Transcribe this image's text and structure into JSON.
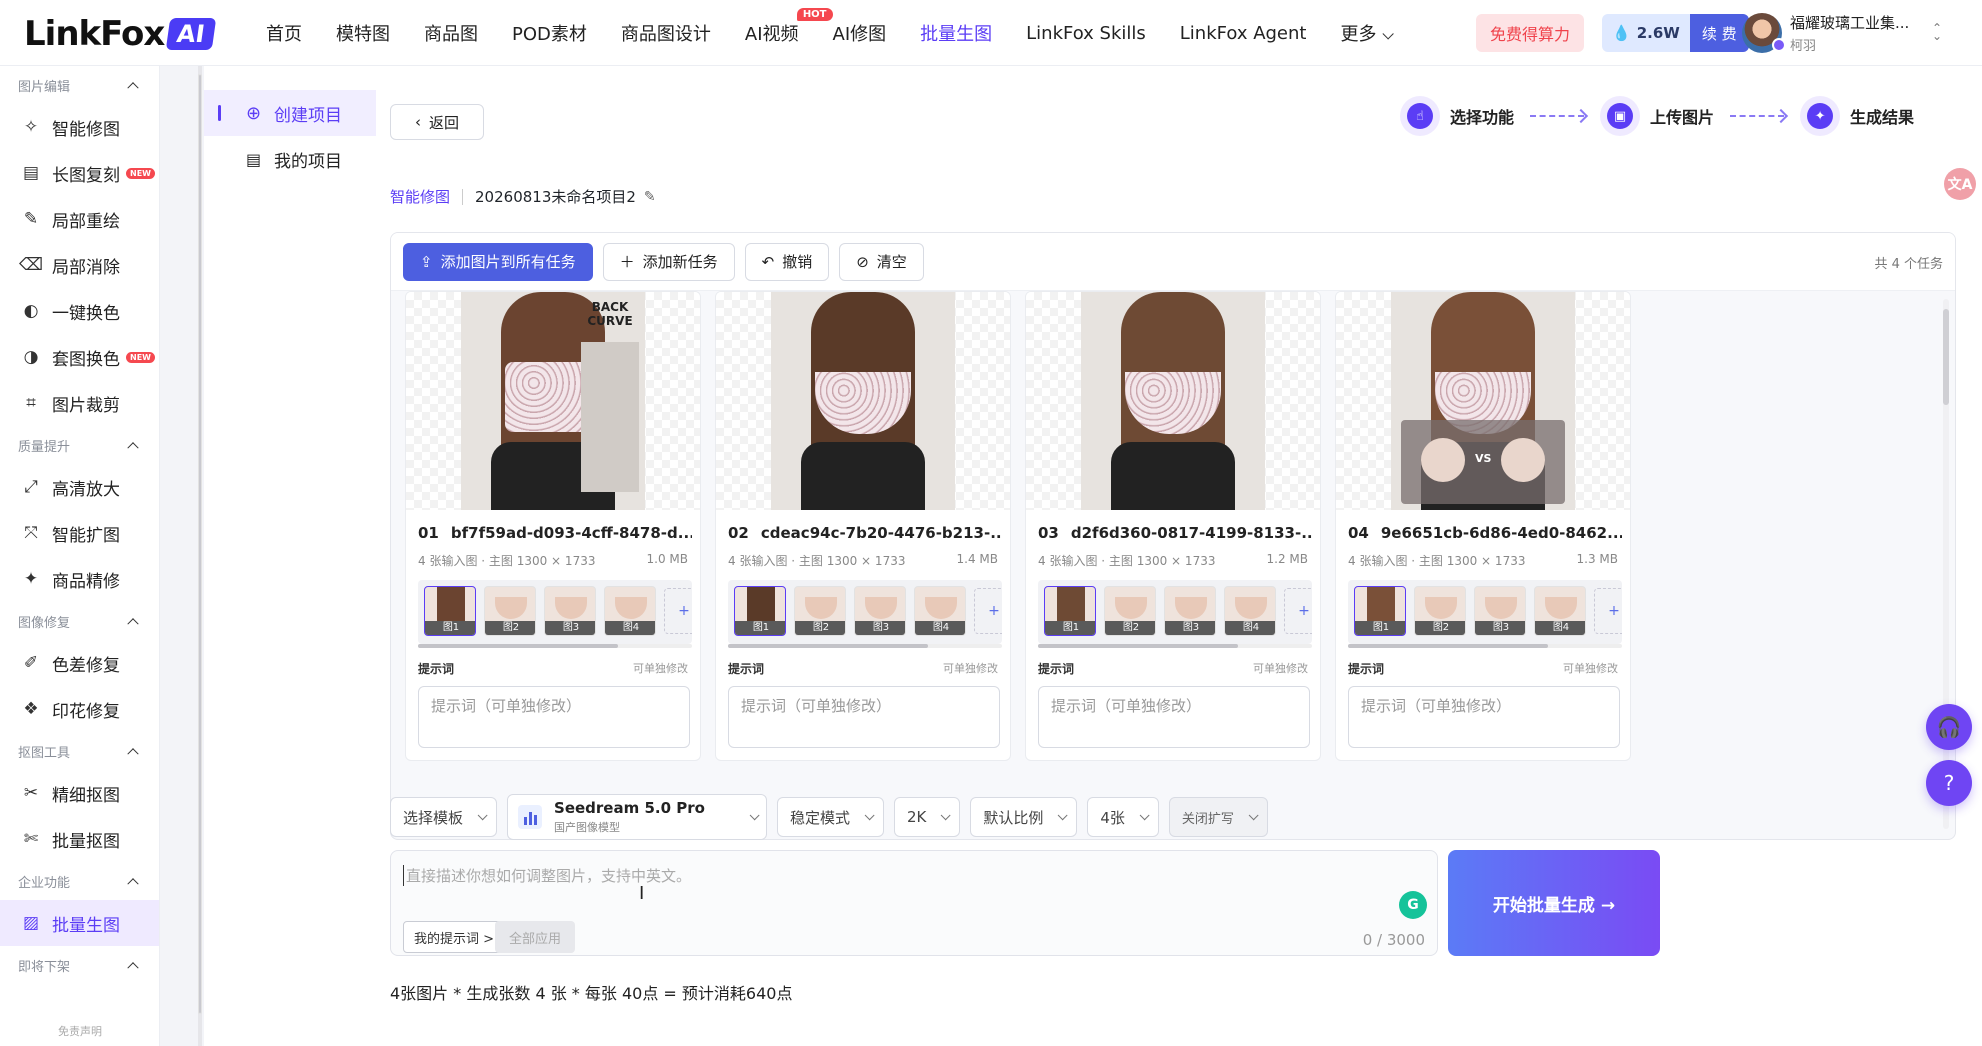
{
  "brand": {
    "name": "LinkFox",
    "badge": "AI"
  },
  "nav": [
    {
      "label": "首页"
    },
    {
      "label": "模特图"
    },
    {
      "label": "商品图"
    },
    {
      "label": "POD素材"
    },
    {
      "label": "商品图设计"
    },
    {
      "label": "AI视频",
      "badge": "HOT"
    },
    {
      "label": "AI修图"
    },
    {
      "label": "批量生图",
      "active": true
    },
    {
      "label": "LinkFox Skills"
    },
    {
      "label": "LinkFox Agent"
    },
    {
      "label": "更多"
    }
  ],
  "header": {
    "free_label": "免费得算力",
    "credits": "2.6W",
    "renew_label": "续 费",
    "user_name": "福耀玻璃工业集...",
    "user_sub": "柯羽"
  },
  "sidebar": {
    "sections": [
      {
        "title": "图片编辑",
        "items": [
          {
            "label": "智能修图",
            "icon": "wand-icon"
          },
          {
            "label": "长图复刻",
            "icon": "doc-icon",
            "new": "NEW"
          },
          {
            "label": "局部重绘",
            "icon": "brush-icon"
          },
          {
            "label": "局部消除",
            "icon": "eraser-icon"
          },
          {
            "label": "一键换色",
            "icon": "palette-icon"
          },
          {
            "label": "套图换色",
            "icon": "palette-set-icon",
            "new": "NEW"
          },
          {
            "label": "图片裁剪",
            "icon": "crop-icon"
          }
        ]
      },
      {
        "title": "质量提升",
        "items": [
          {
            "label": "高清放大",
            "icon": "expand-icon"
          },
          {
            "label": "智能扩图",
            "icon": "extend-icon"
          },
          {
            "label": "商品精修",
            "icon": "retouch-icon"
          }
        ]
      },
      {
        "title": "图像修复",
        "items": [
          {
            "label": "色差修复",
            "icon": "color-fix-icon"
          },
          {
            "label": "印花修复",
            "icon": "pattern-icon"
          }
        ]
      },
      {
        "title": "抠图工具",
        "items": [
          {
            "label": "精细抠图",
            "icon": "cutout-icon"
          },
          {
            "label": "批量抠图",
            "icon": "batch-cutout-icon"
          }
        ]
      },
      {
        "title": "企业功能",
        "items": [
          {
            "label": "批量生图",
            "icon": "image-batch-icon",
            "active": true
          }
        ]
      },
      {
        "title": "即将下架",
        "items": []
      }
    ],
    "footer": "免责声明"
  },
  "projects": {
    "create_label": "创建项目",
    "mine_label": "我的项目"
  },
  "main": {
    "back_label": "返回",
    "steps": [
      "选择功能",
      "上传图片",
      "生成结果"
    ],
    "crumb_func": "智能修图",
    "project_name": "20260813未命名项目2",
    "toolbar": {
      "add_all": "添加图片到所有任务",
      "add_task": "添加新任务",
      "undo": "撤销",
      "clear": "清空",
      "count": "共 4 个任务"
    },
    "cards": [
      {
        "num": "01",
        "id": "bf7f59ad-d093-4cff-8478-d...",
        "meta": "4 张输入图 · 主图 1300 × 1733",
        "size": "1.0 MB",
        "overlay": "BACK CURVE",
        "thumbs": [
          "图1",
          "图2",
          "图3",
          "图4"
        ],
        "prompt_label": "提示词",
        "prompt_edit": "可单独修改",
        "prompt_placeholder": "提示词（可单独修改）"
      },
      {
        "num": "02",
        "id": "cdeac94c-7b20-4476-b213-...",
        "meta": "4 张输入图 · 主图 1300 × 1733",
        "size": "1.4 MB",
        "overlay": "",
        "thumbs": [
          "图1",
          "图2",
          "图3",
          "图4"
        ],
        "prompt_label": "提示词",
        "prompt_edit": "可单独修改",
        "prompt_placeholder": "提示词（可单独修改）"
      },
      {
        "num": "03",
        "id": "d2f6d360-0817-4199-8133-...",
        "meta": "4 张输入图 · 主图 1300 × 1733",
        "size": "1.2 MB",
        "overlay": "",
        "thumbs": [
          "图1",
          "图2",
          "图3",
          "图4"
        ],
        "prompt_label": "提示词",
        "prompt_edit": "可单独修改",
        "prompt_placeholder": "提示词（可单独修改）"
      },
      {
        "num": "04",
        "id": "9e6651cb-6d86-4ed0-8462...",
        "meta": "4 张输入图 · 主图 1300 × 1733",
        "size": "1.3 MB",
        "overlay": "VS",
        "thumbs": [
          "图1",
          "图2",
          "图3",
          "图4"
        ],
        "prompt_label": "提示词",
        "prompt_edit": "可单独修改",
        "prompt_placeholder": "提示词（可单独修改）"
      }
    ],
    "controls": {
      "template": "选择模板",
      "model_name": "Seedream 5.0 Pro",
      "model_sub": "国产图像模型",
      "mode": "稳定模式",
      "resolution": "2K",
      "ratio": "默认比例",
      "count": "4张",
      "expand": "关闭扩写"
    },
    "prompt": {
      "placeholder": "直接描述你想如何调整图片，支持中英文。",
      "my_tips": "我的提示词 >",
      "apply_all": "全部应用",
      "counter": "0 / 3000"
    },
    "generate_label": "开始批量生成 →",
    "cost_text": "4张图片 * 生成张数 4 张 * 每张 40点 = 预计消耗640点"
  },
  "colors": {
    "accent": "#5b3df5",
    "primary_button": "#4d5fe0"
  }
}
